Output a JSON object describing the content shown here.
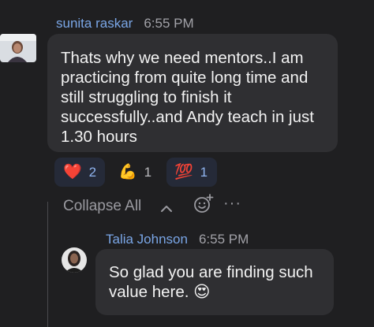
{
  "message1": {
    "sender": "sunita raskar",
    "time": "6:55 PM",
    "text": "Thats why we need mentors..I am practicing from quite long time and still struggling to finish it successfully..and Andy teach in just 1.30 hours"
  },
  "reactions": [
    {
      "emoji": "❤️",
      "icon": "red-heart-icon",
      "count": "2",
      "highlighted": true
    },
    {
      "emoji": "💪",
      "icon": "flexed-biceps-icon",
      "count": "1",
      "highlighted": false
    },
    {
      "emoji": "💯",
      "icon": "hundred-points-icon",
      "count": "1",
      "highlighted": true
    }
  ],
  "thread": {
    "collapse_label": "Collapse All",
    "more_label": "···"
  },
  "message2": {
    "sender": "Talia Johnson",
    "time": "6:55 PM",
    "text": "So glad you are finding such value here. 😍"
  },
  "colors": {
    "background": "#1f1f21",
    "bubble": "#2f2f32",
    "sender_name": "#7aa6e6",
    "reaction_highlight": "#252a38",
    "reaction_count": "#8fb3ee",
    "thread_line": "#4a4a4e"
  }
}
